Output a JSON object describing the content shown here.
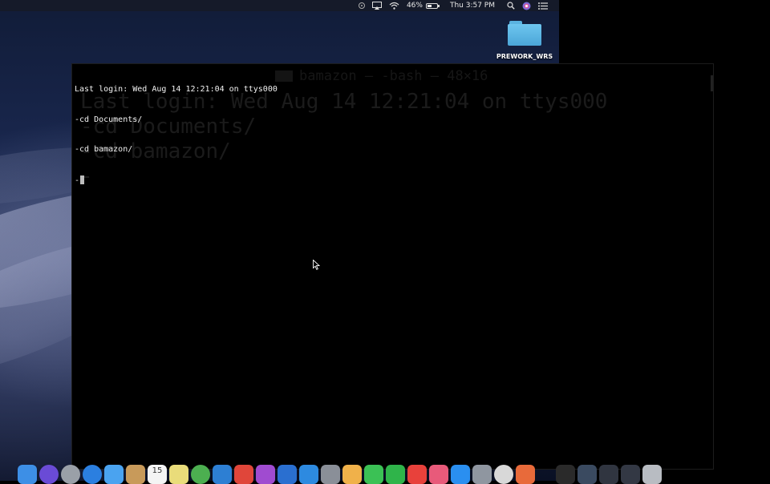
{
  "menubar": {
    "battery_percent": "46%",
    "battery_level": 0.46,
    "clock": "Thu 3:57 PM"
  },
  "desktop": {
    "folder_label": "PREWORK_WRS"
  },
  "terminal": {
    "lines": [
      "Last login: Wed Aug 14 12:21:04 on ttys000",
      "-cd Documents/",
      "-cd bamazon/",
      "-"
    ],
    "ghost_title": "bamazon — -bash — 48×16",
    "ghost_lines": [
      "Last login: Wed Aug 14 12:21:04 on ttys000",
      "-cd Documents/",
      "-cd bamazon/",
      "-"
    ]
  },
  "dock": {
    "calendar_day": "15",
    "icons": [
      {
        "name": "finder-icon",
        "color": "#3d8fe6"
      },
      {
        "name": "siri-icon",
        "color": "#6a4bd6"
      },
      {
        "name": "launchpad-icon",
        "color": "#9aa0a8"
      },
      {
        "name": "safari-icon",
        "color": "#2b7fe0"
      },
      {
        "name": "mail-icon",
        "color": "#4aa3f0"
      },
      {
        "name": "contacts-icon",
        "color": "#c89a5a"
      },
      {
        "name": "calendar-icon",
        "color": "#f4f4f4"
      },
      {
        "name": "notes-icon",
        "color": "#e9dc7a"
      },
      {
        "name": "chrome-icon",
        "color": "#4caf50"
      },
      {
        "name": "vscode-icon",
        "color": "#2d7fd3"
      },
      {
        "name": "app-red-icon",
        "color": "#e0463a"
      },
      {
        "name": "app-purple-icon",
        "color": "#a04bd0"
      },
      {
        "name": "xcode-icon",
        "color": "#2a6fd0"
      },
      {
        "name": "app-blue-icon",
        "color": "#2d8ae0"
      },
      {
        "name": "app-grey-icon",
        "color": "#8a8f98"
      },
      {
        "name": "photos-icon",
        "color": "#f0b14a"
      },
      {
        "name": "messages-icon",
        "color": "#3bc155"
      },
      {
        "name": "facetime-icon",
        "color": "#2fb44a"
      },
      {
        "name": "news-icon",
        "color": "#e8413b"
      },
      {
        "name": "music-icon",
        "color": "#e85a7a"
      },
      {
        "name": "appstore-icon",
        "color": "#2a8ff0"
      },
      {
        "name": "preferences-icon",
        "color": "#8f96a0"
      },
      {
        "name": "chrome-alt-icon",
        "color": "#d8d8d8"
      },
      {
        "name": "app-orange-icon",
        "color": "#e86a3a"
      },
      {
        "name": "terminal-icon",
        "color": "#2a2a2a"
      },
      {
        "name": "window-1-icon",
        "color": "#3a4a60"
      },
      {
        "name": "window-2-icon",
        "color": "#303540"
      },
      {
        "name": "window-3-icon",
        "color": "#333844"
      },
      {
        "name": "trash-icon",
        "color": "#b8bcc2"
      }
    ]
  }
}
